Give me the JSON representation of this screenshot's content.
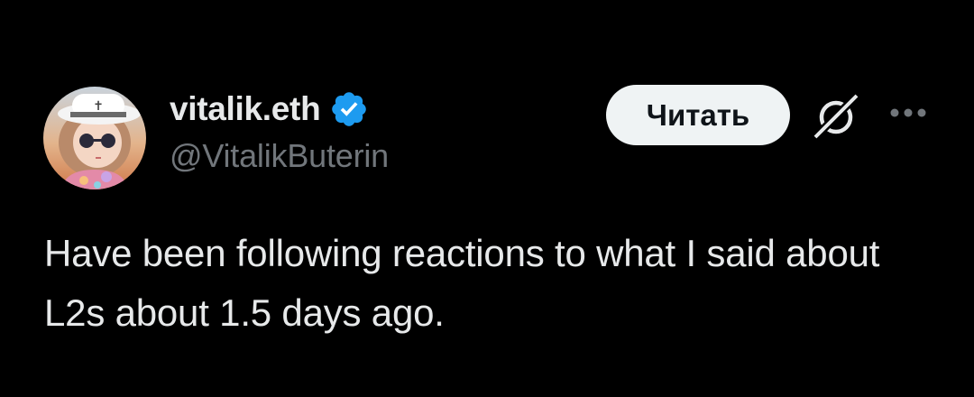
{
  "author": {
    "display_name": "vitalik.eth",
    "handle": "@VitalikButerin",
    "verified": true,
    "avatar_icon": "profile-avatar"
  },
  "actions": {
    "subscribe_label": "Читать",
    "grok_icon": "grok-icon",
    "more_icon": "more-options-icon"
  },
  "tweet": {
    "text": "Have been following reactions to what I said about L2s about 1.5 days ago."
  },
  "colors": {
    "background": "#000000",
    "text_primary": "#e7e9ea",
    "text_secondary": "#71767b",
    "verified_blue": "#1d9bf0",
    "button_bg": "#eff3f4",
    "button_text": "#0f1419"
  }
}
